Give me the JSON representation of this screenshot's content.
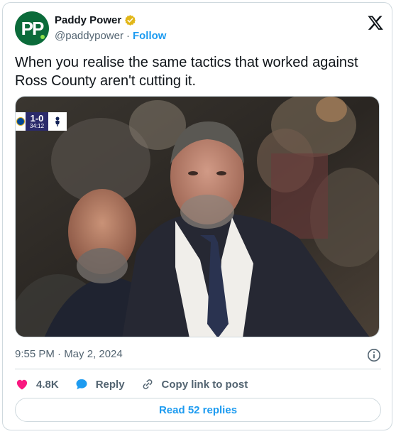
{
  "author": {
    "display_name": "Paddy Power",
    "handle": "@paddypower",
    "separator": "·",
    "follow_label": "Follow",
    "avatar_initials": "PP",
    "verified": true
  },
  "tweet": {
    "text": "When you realise the same tactics that worked against Ross County aren't cutting it."
  },
  "media": {
    "scoreboard": {
      "score": "1-0",
      "clock": "34:12"
    }
  },
  "meta": {
    "timestamp": "9:55 PM · May 2, 2024"
  },
  "actions": {
    "likes_count": "4.8K",
    "reply_label": "Reply",
    "copy_link_label": "Copy link to post"
  },
  "replies_button_label": "Read 52 replies",
  "colors": {
    "link_blue": "#1d9bf0",
    "heart_red": "#f91880",
    "muted_text": "#536471",
    "verified_gold": "#e2b719",
    "avatar_green": "#0b6b3a"
  },
  "icons": {
    "verified": "verified-badge-icon",
    "x_logo": "x-logo-icon",
    "info": "info-icon",
    "like": "heart-icon",
    "reply": "speech-bubble-icon",
    "copy_link": "link-icon"
  }
}
